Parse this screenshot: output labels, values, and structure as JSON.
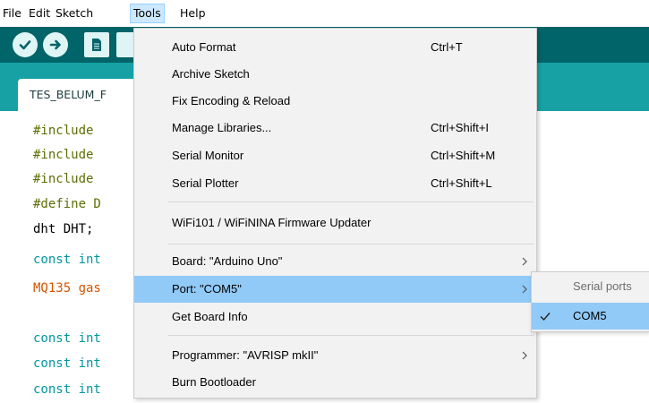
{
  "menubar": {
    "items": [
      "File",
      "Edit",
      "Sketch",
      "Tools",
      "Help"
    ]
  },
  "toolbar": {
    "buttons": [
      "verify-button",
      "upload-button",
      "new-button",
      "open-button"
    ]
  },
  "tab": {
    "title": "TES_BELUM_F"
  },
  "code": [
    "#include",
    "#include",
    "#include",
    "#define D",
    "dht DHT;",
    "const int",
    "MQ135 gas",
    "",
    "const int",
    "const int",
    "const int"
  ],
  "tools_menu": {
    "items": [
      {
        "label": "Auto Format",
        "shortcut": "Ctrl+T"
      },
      {
        "label": "Archive Sketch",
        "shortcut": ""
      },
      {
        "label": "Fix Encoding & Reload",
        "shortcut": ""
      },
      {
        "label": "Manage Libraries...",
        "shortcut": "Ctrl+Shift+I"
      },
      {
        "label": "Serial Monitor",
        "shortcut": "Ctrl+Shift+M"
      },
      {
        "label": "Serial Plotter",
        "shortcut": "Ctrl+Shift+L"
      },
      {
        "label": "WiFi101 / WiFiNINA Firmware Updater",
        "shortcut": ""
      },
      {
        "label": "Board: \"Arduino Uno\"",
        "shortcut": ""
      },
      {
        "label": "Port: \"COM5\"",
        "shortcut": ""
      },
      {
        "label": "Get Board Info",
        "shortcut": ""
      },
      {
        "label": "Programmer: \"AVRISP mkII\"",
        "shortcut": ""
      },
      {
        "label": "Burn Bootloader",
        "shortcut": ""
      }
    ]
  },
  "port_submenu": {
    "header": "Serial ports",
    "item": "COM5"
  },
  "colors": {
    "toolbar": "#006468",
    "tabstrip": "#17a1a5",
    "highlight": "#91c9f7",
    "menu_bg": "#f2f2f2"
  }
}
